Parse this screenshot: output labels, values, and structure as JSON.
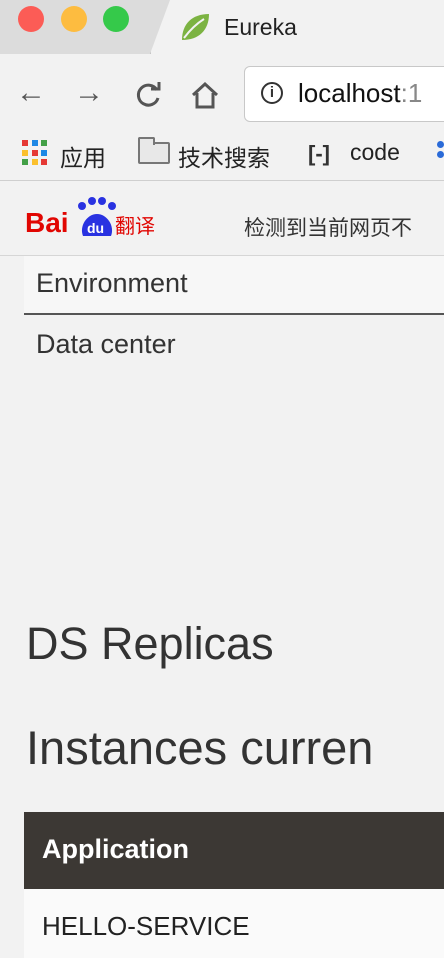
{
  "window": {
    "tab_title": "Eureka"
  },
  "toolbar": {
    "back_icon": "←",
    "forward_icon": "→",
    "reload_icon": "C",
    "home_icon": "⌂",
    "url_main": "localhost",
    "url_rest": ":1"
  },
  "bookmarks": [
    {
      "label": "应用"
    },
    {
      "label": "技术搜索"
    },
    {
      "label": "code"
    }
  ],
  "translate_bar": {
    "message": "检测到当前网页不"
  },
  "page": {
    "rows": {
      "environment": "Environment",
      "data_center": "Data center"
    },
    "ds_replicas_heading": "DS Replicas",
    "instances_heading": "Instances curren",
    "table": {
      "header": "Application",
      "rows": [
        "HELLO-SERVICE"
      ]
    }
  },
  "colors": {
    "table_header_bg": "#3c3834",
    "page_bg": "#f2f2f2"
  }
}
